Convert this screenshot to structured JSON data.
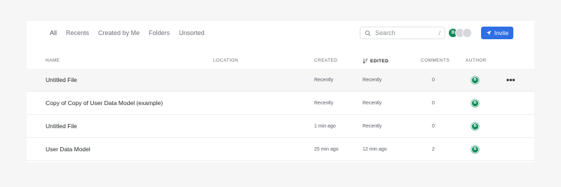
{
  "filters": [
    "All",
    "Recents",
    "Created by Me",
    "Folders",
    "Unsorted"
  ],
  "search": {
    "placeholder": "Search",
    "shortcut": "/"
  },
  "avatars": [
    {
      "initial": "B",
      "color": "#0f8a5b"
    },
    {
      "initial": "",
      "color": "#d6d8db"
    },
    {
      "initial": "",
      "color": "#d6d8db"
    }
  ],
  "invite_label": "Invite",
  "accent_color": "#2f6fe4",
  "columns": {
    "name": "NAME",
    "location": "LOCATION",
    "created": "CREATED",
    "edited": "EDITED",
    "comments": "COMMENTS",
    "author": "AUTHOR"
  },
  "rows": [
    {
      "name": "Untitled File",
      "created": "Recently",
      "edited": "Recently",
      "comments": "0",
      "author": "B",
      "more": "•••"
    },
    {
      "name": "Copy of Copy of User Data Model (example)",
      "created": "Recently",
      "edited": "Recently",
      "comments": "0",
      "author": "B"
    },
    {
      "name": "Untitled File",
      "created": "1 min ago",
      "edited": "Recently",
      "comments": "0",
      "author": "B"
    },
    {
      "name": "User Data Model",
      "created": "25 min ago",
      "edited": "12 min ago",
      "comments": "2",
      "author": "B"
    }
  ]
}
